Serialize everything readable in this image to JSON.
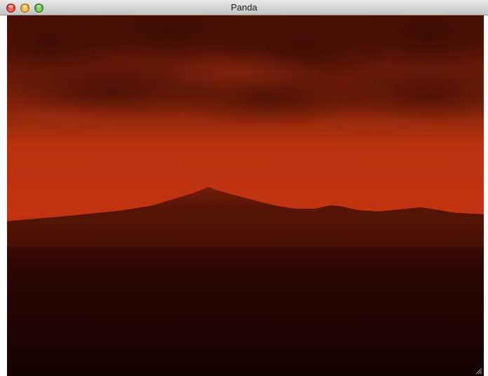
{
  "window": {
    "title": "Panda"
  },
  "titlebar": {
    "buttons": [
      {
        "name": "close",
        "color": "#e2392b"
      },
      {
        "name": "minimize",
        "color": "#e9a21d"
      },
      {
        "name": "zoom",
        "color": "#4fae34"
      }
    ]
  },
  "colors": {
    "sky_top": "#5a1406",
    "haze": "#c0320f",
    "ground_near": "#170300"
  }
}
